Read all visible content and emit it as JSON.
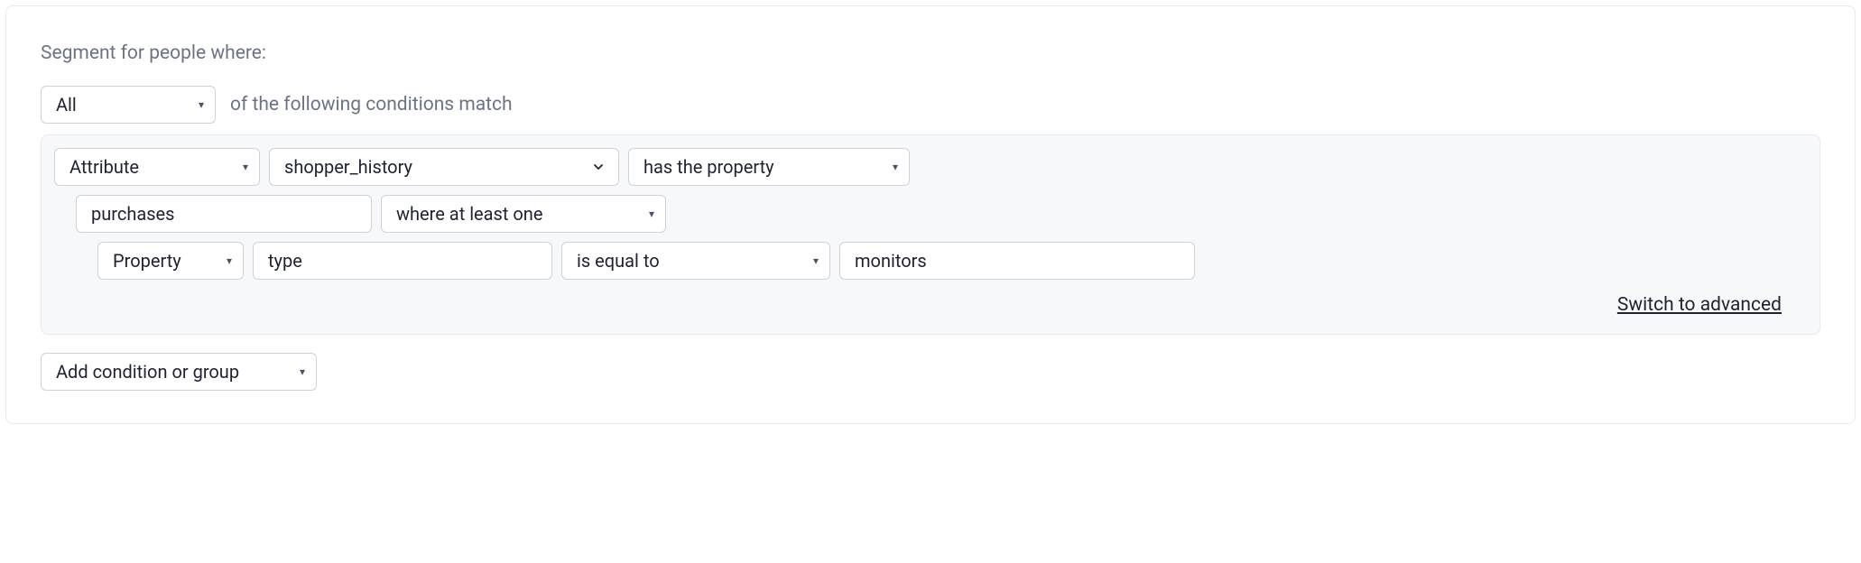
{
  "header": {
    "title": "Segment for people where:"
  },
  "top": {
    "operator": "All",
    "suffix": "of the following conditions match"
  },
  "condition": {
    "type_select": "Attribute",
    "attribute_name": "shopper_history",
    "predicate": "has the property",
    "nested": {
      "property": "purchases",
      "quantifier": "where at least one",
      "inner": {
        "kind": "Property",
        "field": "type",
        "comparator": "is equal to",
        "value": "monitors"
      }
    }
  },
  "links": {
    "advanced": "Switch to advanced"
  },
  "footer": {
    "add_button": "Add condition or group"
  }
}
